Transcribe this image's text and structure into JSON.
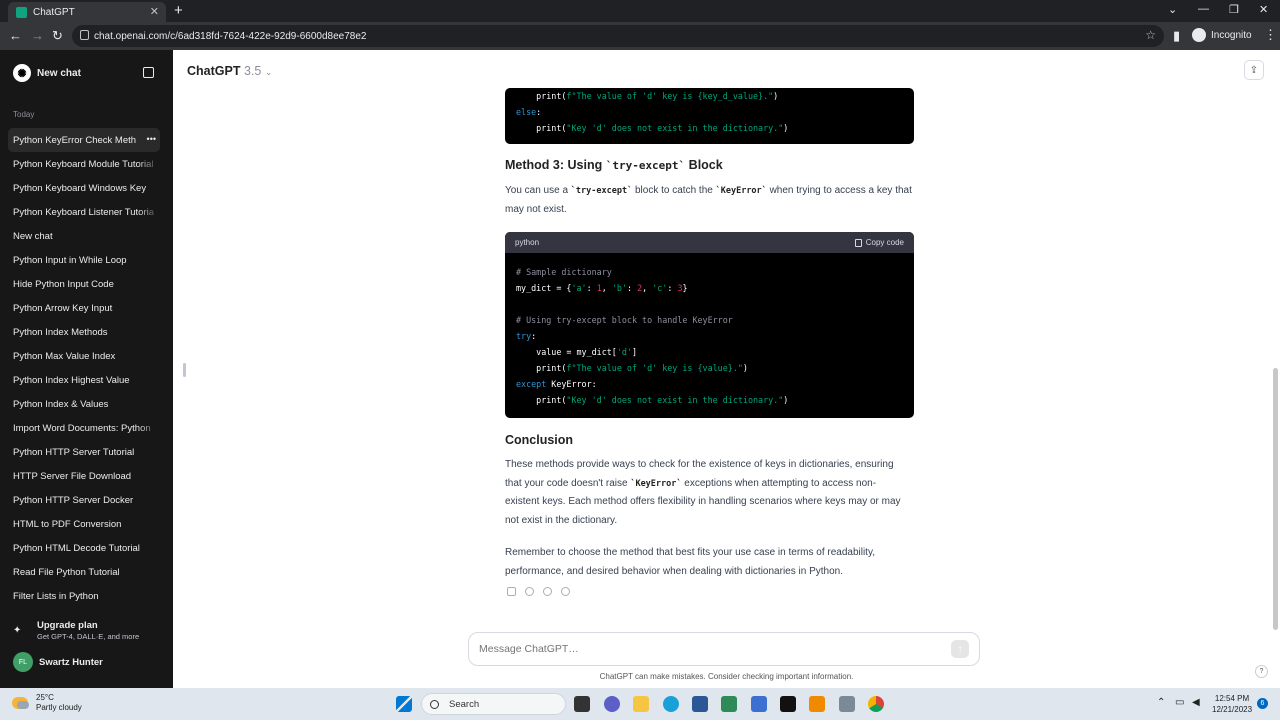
{
  "browser": {
    "tab_title": "ChatGPT",
    "url": "chat.openai.com/c/6ad318fd-7624-422e-92d9-6600d8ee78e2",
    "profile": "Incognito"
  },
  "sidebar": {
    "new_chat": "New chat",
    "section_today": "Today",
    "items": [
      "Python KeyError Check Meth",
      "Python Keyboard Module Tutorial",
      "Python Keyboard Windows Key",
      "Python Keyboard Listener Tutoria",
      "New chat",
      "Python Input in While Loop",
      "Hide Python Input Code",
      "Python Arrow Key Input",
      "Python Index Methods",
      "Python Max Value Index",
      "Python Index Highest Value",
      "Python Index & Values",
      "Import Word Documents: Python",
      "Python HTTP Server Tutorial",
      "HTTP Server File Download",
      "Python HTTP Server Docker",
      "HTML to PDF Conversion",
      "Python HTML Decode Tutorial",
      "Read File Python Tutorial",
      "Filter Lists in Python"
    ],
    "upgrade_title": "Upgrade plan",
    "upgrade_sub": "Get GPT-4, DALL·E, and more",
    "user_initials": "FL",
    "user_name": "Swartz Hunter"
  },
  "header": {
    "model": "ChatGPT",
    "version": "3.5"
  },
  "content": {
    "code1_line1_pre": "    print(",
    "code1_line1_str": "f\"The value of 'd' key is {key_d_value}.\"",
    "code1_line1_post": ")",
    "code1_else": "else",
    "code1_line3_str": "\"Key 'd' does not exist in the dictionary.\"",
    "method3_pre": "Method 3: Using ",
    "method3_code": "`try-except`",
    "method3_post": " Block",
    "p1_a": "You can use a ",
    "p1_code1": "`try-except`",
    "p1_b": " block to catch the ",
    "p1_code2": "`KeyError`",
    "p1_c": " when trying to access a key that may not exist.",
    "code2_lang": "python",
    "code2_copy": "Copy code",
    "code2_comment1": "# Sample dictionary",
    "code2_comment2": "# Using try-except block to handle KeyError",
    "conclusion": "Conclusion",
    "p2_a": "These methods provide ways to check for the existence of keys in dictionaries, ensuring that your code doesn't raise ",
    "p2_code": "`KeyError`",
    "p2_b": " exceptions when attempting to access non-existent keys. Each method offers flexibility in handling scenarios where keys may or may not exist in the dictionary.",
    "p3": "Remember to choose the method that best fits your use case in terms of readability, performance, and desired behavior when dealing with dictionaries in Python."
  },
  "composer": {
    "placeholder": "Message ChatGPT…",
    "disclaimer": "ChatGPT can make mistakes. Consider checking important information."
  },
  "taskbar": {
    "temp": "25°C",
    "condition": "Partly cloudy",
    "search": "Search",
    "time": "12:54 PM",
    "date": "12/21/2023",
    "notifications": "6"
  }
}
